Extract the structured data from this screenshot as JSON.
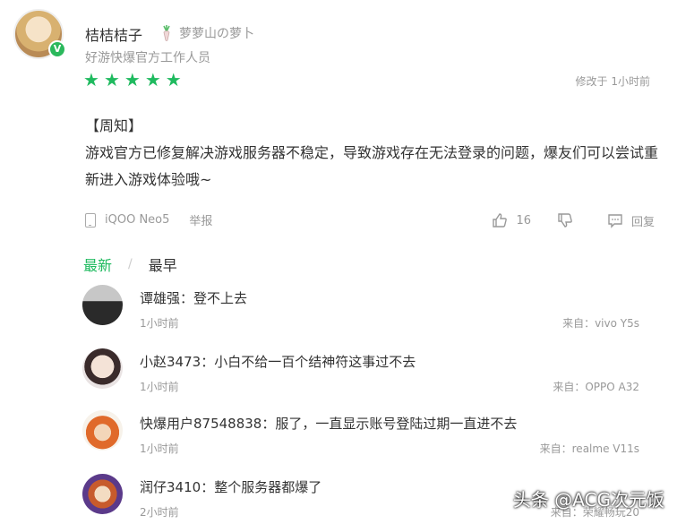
{
  "review": {
    "author_name": "桔桔桔子",
    "author_tag": "萝萝山の萝卜",
    "author_role": "好游快爆官方工作人员",
    "verified_badge": "V",
    "rating_stars": 5,
    "modified": "修改于 1小时前",
    "content_line1": "【周知】",
    "content_line2": "游戏官方已修复解决游戏服务器不稳定，导致游戏存在无法登录的问题，爆友们可以尝试重新进入游戏体验哦~",
    "device": "iQOO Neo5",
    "report": "举报",
    "like_count": "16",
    "reply": "回复"
  },
  "sort": {
    "newest": "最新",
    "separator": "/",
    "earliest": "最早"
  },
  "replies": [
    {
      "user": "谭雄强",
      "text": "登不上去",
      "time": "1小时前",
      "device": "来自：vivo Y5s"
    },
    {
      "user": "小赵3473",
      "text": "小白不给一百个结神符这事过不去",
      "time": "1小时前",
      "device": "来自：OPPO A32"
    },
    {
      "user": "快爆用户87548838",
      "text": "服了，一直显示账号登陆过期一直进不去",
      "time": "1小时前",
      "device": "来自：realme V11s"
    },
    {
      "user": "润仔3410",
      "text": "整个服务器都爆了",
      "time": "2小时前",
      "device": "来自：荣耀畅玩20"
    }
  ],
  "watermark": "头条 @ACG次元饭",
  "colors": {
    "accent": "#1fba5f",
    "muted": "#999999"
  }
}
